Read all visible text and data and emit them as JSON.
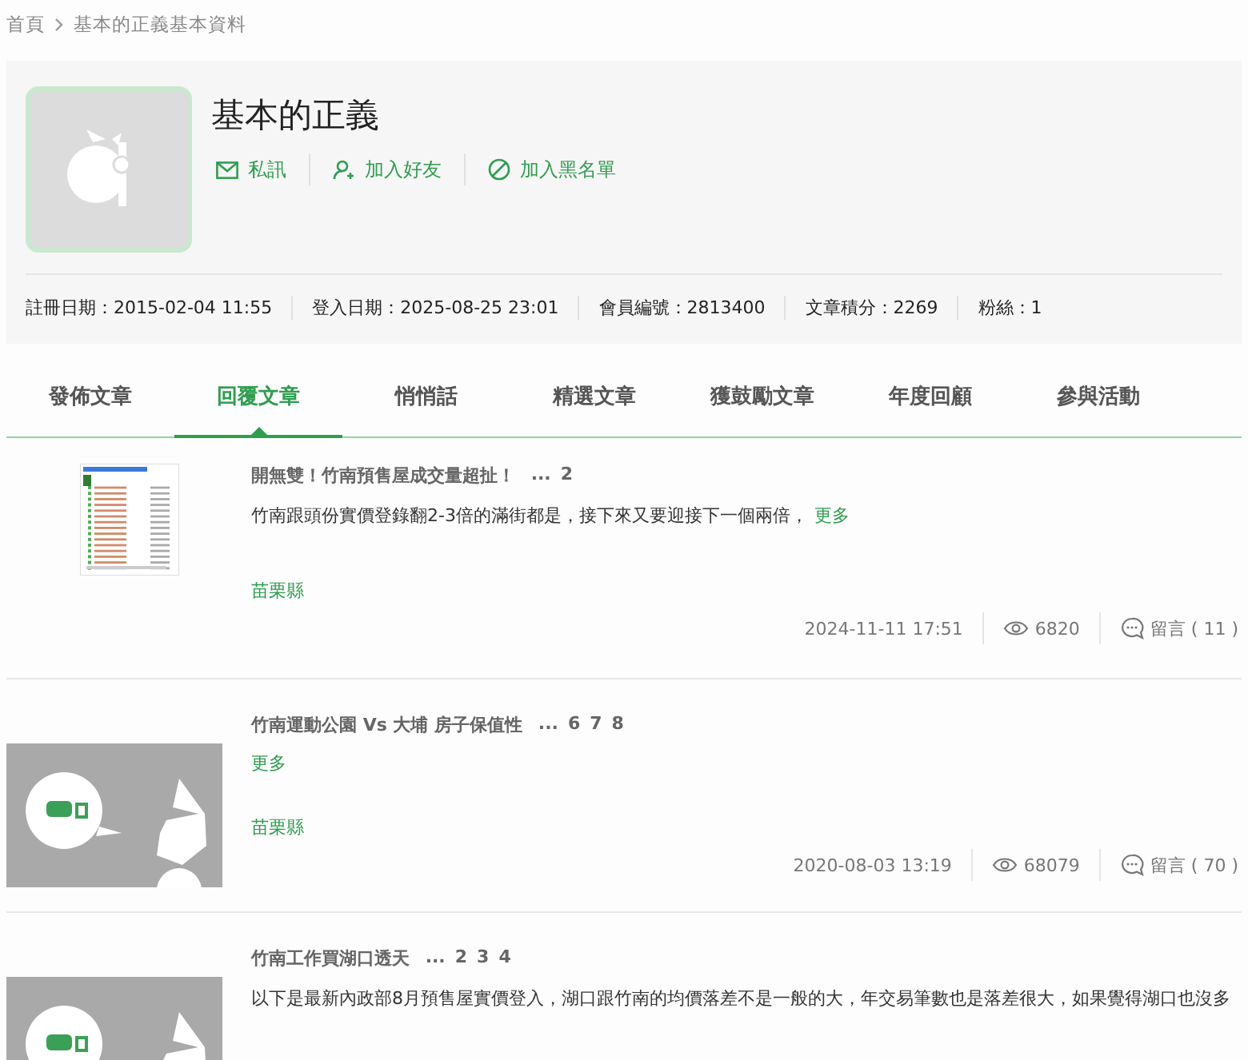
{
  "breadcrumb": [
    "首頁",
    "基本的正義基本資料"
  ],
  "profile": {
    "name": "基本的正義",
    "actions": [
      {
        "kind": "message",
        "label": "私訊"
      },
      {
        "kind": "friend",
        "label": "加入好友"
      },
      {
        "kind": "block",
        "label": "加入黑名單"
      }
    ],
    "stats": [
      "註冊日期：2015-02-04 11:55",
      "登入日期：2025-08-25 23:01",
      "會員編號：2813400",
      "文章積分：2269",
      "粉絲：1"
    ]
  },
  "tabs": [
    {
      "label": "發佈文章",
      "selected": false
    },
    {
      "label": "回覆文章",
      "selected": true
    },
    {
      "label": "悄悄話",
      "selected": false
    },
    {
      "label": "精選文章",
      "selected": false
    },
    {
      "label": "獲鼓勵文章",
      "selected": false
    },
    {
      "label": "年度回顧",
      "selected": false
    },
    {
      "label": "參與活動",
      "selected": false
    }
  ],
  "posts": [
    {
      "kind": "screenshot",
      "title": "開無雙！竹南預售屋成交量超扯！",
      "ellipsis": "...",
      "pages": [
        "2"
      ],
      "excerpt": "竹南跟頭份實價登錄翻2-3倍的滿街都是，接下來又要迎接下一個兩倍，",
      "more": "更多",
      "location": "苗栗縣",
      "date": "2024-11-11 17:51",
      "views": "6820",
      "comments": "留言 ( 11 )"
    },
    {
      "kind": "illustration",
      "title": "竹南運動公園 Vs 大埔 房子保值性",
      "ellipsis": "...",
      "pages": [
        "6",
        "7",
        "8"
      ],
      "more": "更多",
      "location": "苗栗縣",
      "date": "2020-08-03 13:19",
      "views": "68079",
      "comments": "留言 ( 70 )"
    },
    {
      "kind": "illustration",
      "title": "竹南工作買湖口透天",
      "ellipsis": "...",
      "pages": [
        "2",
        "3",
        "4"
      ],
      "excerpt": "以下是最新內政部8月預售屋實價登入，湖口跟竹南的均價落差不是一般的大，年交易筆數也是落差很大，如果覺得湖口也沒多"
    }
  ]
}
